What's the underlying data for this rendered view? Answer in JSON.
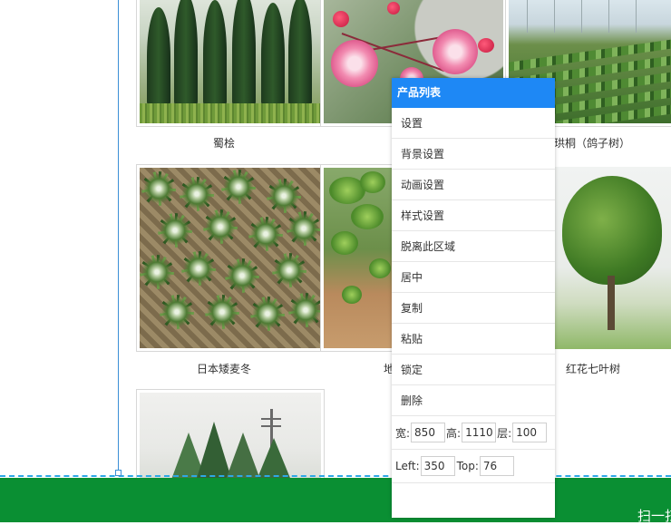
{
  "products": [
    {
      "name": "蜀桧"
    },
    {
      "name": ""
    },
    {
      "name": "珙桐（鸽子树）"
    },
    {
      "name": "日本矮麦冬"
    },
    {
      "name": "地"
    },
    {
      "name": "红花七叶树"
    },
    {
      "name": ""
    }
  ],
  "context_menu": {
    "title": "产品列表",
    "items": [
      "设置",
      "背景设置",
      "动画设置",
      "样式设置",
      "脱离此区域",
      "居中",
      "复制",
      "粘贴",
      "锁定",
      "删除"
    ],
    "width_label": "宽:",
    "width_value": "850",
    "height_label": "高:",
    "height_value": "1110",
    "layer_label": "层:",
    "layer_value": "100",
    "left_label": "Left:",
    "left_value": "350",
    "top_label": "Top:",
    "top_value": "76"
  },
  "footer": {
    "text": "扫一扫"
  }
}
